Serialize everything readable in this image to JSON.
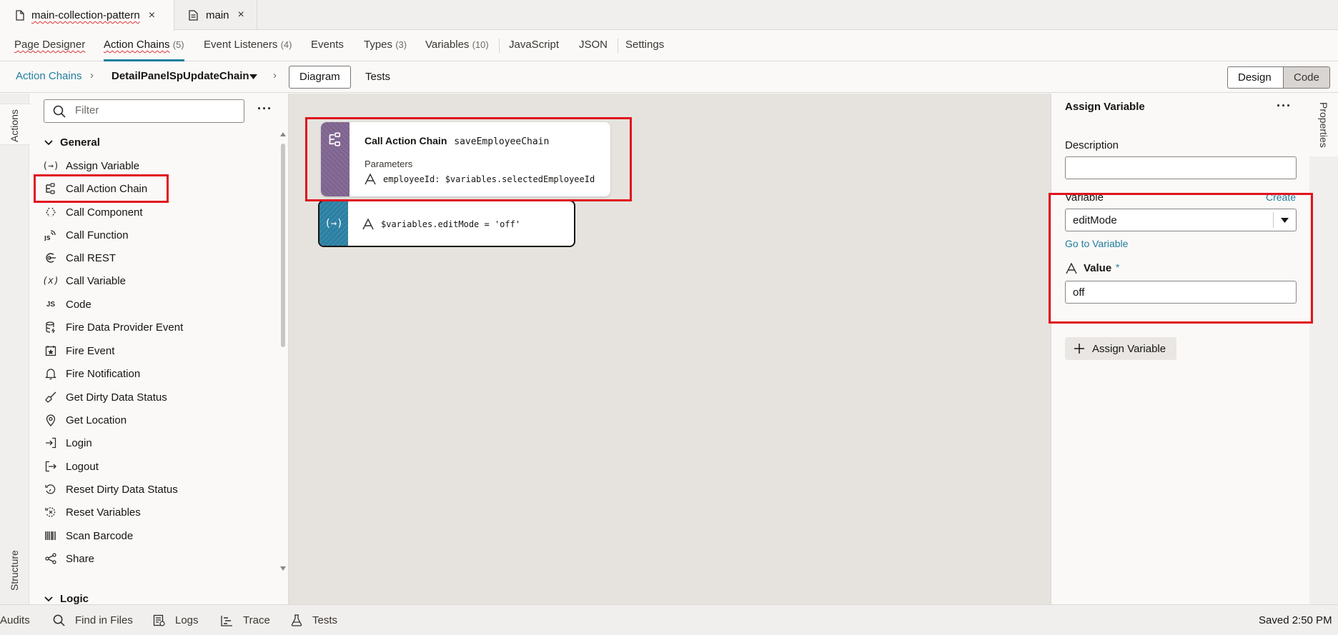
{
  "file_tabs": [
    {
      "label": "main-collection-pattern",
      "close": "×"
    },
    {
      "label": "main",
      "close": "×"
    }
  ],
  "editor_tabs": [
    {
      "label": "Page Designer",
      "count": ""
    },
    {
      "label": "Action Chains",
      "count": "(5)"
    },
    {
      "label": "Event Listeners",
      "count": "(4)"
    },
    {
      "label": "Events",
      "count": ""
    },
    {
      "label": "Types",
      "count": "(3)"
    },
    {
      "label": "Variables",
      "count": "(10)"
    },
    {
      "label": "JavaScript",
      "count": ""
    },
    {
      "label": "JSON",
      "count": ""
    },
    {
      "label": "Settings",
      "count": ""
    }
  ],
  "breadcrumb": {
    "root": "Action Chains",
    "current": "DetailPanelSpUpdateChain",
    "view_diagram": "Diagram",
    "view_tests": "Tests"
  },
  "mode": {
    "design": "Design",
    "code": "Code"
  },
  "left_rail": {
    "actions": "Actions",
    "structure": "Structure"
  },
  "actions_panel": {
    "filter_placeholder": "Filter",
    "more": "···",
    "group_general": "General",
    "items": [
      {
        "label": "Assign Variable",
        "icon": "(→)"
      },
      {
        "label": "Call Action Chain",
        "icon": "chain"
      },
      {
        "label": "Call Component",
        "icon": "‹⟩"
      },
      {
        "label": "Call Function",
        "icon": "JS"
      },
      {
        "label": "Call REST",
        "icon": "rest"
      },
      {
        "label": "Call Variable",
        "icon": "(x)"
      },
      {
        "label": "Code",
        "icon": "JS"
      },
      {
        "label": "Fire Data Provider Event",
        "icon": "db"
      },
      {
        "label": "Fire Event",
        "icon": "★"
      },
      {
        "label": "Fire Notification",
        "icon": "bell"
      },
      {
        "label": "Get Dirty Data Status",
        "icon": "broom"
      },
      {
        "label": "Get Location",
        "icon": "pin"
      },
      {
        "label": "Login",
        "icon": "→]"
      },
      {
        "label": "Logout",
        "icon": "[→"
      },
      {
        "label": "Reset Dirty Data Status",
        "icon": "reset"
      },
      {
        "label": "Reset Variables",
        "icon": "reset"
      },
      {
        "label": "Scan Barcode",
        "icon": "||||"
      },
      {
        "label": "Share",
        "icon": "share"
      }
    ],
    "group_logic": "Logic"
  },
  "canvas": {
    "node1": {
      "title": "Call Action Chain",
      "chain": "saveEmployeeChain",
      "params_label": "Parameters",
      "param": "employeeId: $variables.selectedEmployeeId"
    },
    "node2": {
      "expr": "$variables.editMode = 'off'"
    }
  },
  "properties": {
    "title": "Assign Variable",
    "more": "···",
    "description_label": "Description",
    "description_value": "",
    "variable_label": "Variable",
    "create_link": "Create",
    "variable_value": "editMode",
    "go_to_variable": "Go to Variable",
    "value_label": "Value",
    "required_mark": "*",
    "value_value": "off",
    "add_button": "Assign Variable"
  },
  "right_rail": {
    "properties": "Properties"
  },
  "status_bar": {
    "audits": "Audits",
    "find": "Find in Files",
    "logs": "Logs",
    "trace": "Trace",
    "tests": "Tests",
    "saved": "Saved 2:50 PM"
  },
  "colors": {
    "accent": "#227e9e",
    "highlight": "#e0141e",
    "chain_stripe": "#7e638f",
    "assign_stripe": "#2a7fa2"
  }
}
